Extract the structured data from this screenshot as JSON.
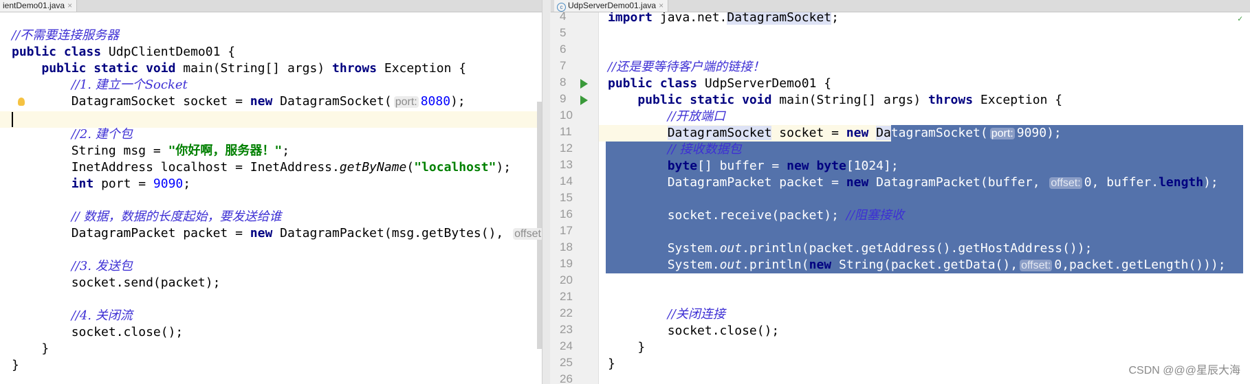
{
  "tabs": [
    {
      "label": "ientDemo01.java",
      "close": "×"
    },
    {
      "label": "UdpServerDemo01.java",
      "close": "×",
      "icon": "java-class-icon",
      "icon_glyph": "c"
    }
  ],
  "colors": {
    "selection": "#5472ab",
    "keyword": "#000080",
    "comment": "#3d2fd4",
    "string": "#008000",
    "number": "#0000ff",
    "run": "#3a9a3a"
  },
  "left_editor": {
    "lines": [
      [
        [
          "cm",
          "//不需要连接服务器"
        ]
      ],
      [
        [
          "kw",
          "public class "
        ],
        [
          "p",
          "UdpClientDemo01 {"
        ]
      ],
      [
        [
          "p",
          "    "
        ],
        [
          "kw",
          "public static void "
        ],
        [
          "p",
          "main(String[] args) "
        ],
        [
          "kw",
          "throws "
        ],
        [
          "p",
          "Exception {"
        ]
      ],
      [
        [
          "p",
          "        "
        ],
        [
          "cm",
          "//1. 建立一个Socket"
        ]
      ],
      [
        [
          "p",
          "        DatagramSocket socket = "
        ],
        [
          "kw",
          "new "
        ],
        [
          "p",
          "DatagramSocket("
        ],
        [
          "hint",
          "port:"
        ],
        [
          "num",
          "8080"
        ],
        [
          "p",
          ");"
        ]
      ],
      [],
      [
        [
          "p",
          "        "
        ],
        [
          "cm",
          "//2. 建个包"
        ]
      ],
      [
        [
          "p",
          "        String msg = "
        ],
        [
          "str",
          "\"你好啊，服务器！\""
        ],
        [
          "p",
          ";"
        ]
      ],
      [
        [
          "p",
          "        InetAddress localhost = InetAddress."
        ],
        [
          "it",
          "getByName"
        ],
        [
          "p",
          "("
        ],
        [
          "str",
          "\"localhost\""
        ],
        [
          "p",
          ");"
        ]
      ],
      [
        [
          "p",
          "        "
        ],
        [
          "kw",
          "int "
        ],
        [
          "p",
          "port = "
        ],
        [
          "num",
          "9090"
        ],
        [
          "p",
          ";"
        ]
      ],
      [],
      [
        [
          "p",
          "        "
        ],
        [
          "cm",
          "// 数据，数据的长度起始，要发送给谁"
        ]
      ],
      [
        [
          "p",
          "        DatagramPacket packet = "
        ],
        [
          "kw",
          "new "
        ],
        [
          "p",
          "DatagramPacket(msg.getBytes(), "
        ],
        [
          "hint",
          "offset:"
        ]
      ],
      [],
      [
        [
          "p",
          "        "
        ],
        [
          "cm",
          "//3. 发送包"
        ]
      ],
      [
        [
          "p",
          "        socket.send(packet);"
        ]
      ],
      [],
      [
        [
          "p",
          "        "
        ],
        [
          "cm",
          "//4. 关闭流"
        ]
      ],
      [
        [
          "p",
          "        socket.close();"
        ]
      ],
      [
        [
          "p",
          "    }"
        ]
      ],
      [
        [
          "p",
          "}"
        ]
      ]
    ]
  },
  "right_editor": {
    "first_line_number": 4,
    "lines": [
      [
        [
          "kw",
          "import "
        ],
        [
          "p",
          "java.net."
        ],
        [
          "us",
          "DatagramSocket"
        ],
        [
          "p",
          ";"
        ]
      ],
      [],
      [],
      [
        [
          "cm",
          "//还是要等待客户端的链接！"
        ]
      ],
      [
        [
          "kw",
          "public class "
        ],
        [
          "p",
          "UdpServerDemo01 {"
        ]
      ],
      [
        [
          "p",
          "    "
        ],
        [
          "kw",
          "public static void "
        ],
        [
          "p",
          "main(String[] args) "
        ],
        [
          "kw",
          "throws "
        ],
        [
          "p",
          "Exception {"
        ]
      ],
      [
        [
          "p",
          "        "
        ],
        [
          "cm",
          "//开放端口"
        ]
      ],
      [
        [
          "p",
          "        "
        ],
        [
          "us",
          "DatagramSocket"
        ],
        [
          "p",
          " socket = "
        ],
        [
          "kw",
          "new "
        ],
        [
          "us",
          "Da"
        ],
        [
          "ps",
          "tagramSocket("
        ],
        [
          "hints",
          "port:"
        ],
        [
          "ps",
          "9090);"
        ]
      ],
      [
        [
          "p",
          "        "
        ],
        [
          "cm",
          "// 接收数据包"
        ]
      ],
      [
        [
          "p",
          "        "
        ],
        [
          "kw",
          "byte"
        ],
        [
          "p",
          "[] buffer = "
        ],
        [
          "kw",
          "new byte"
        ],
        [
          "p",
          "[1024];"
        ]
      ],
      [
        [
          "p",
          "        DatagramPacket packet = "
        ],
        [
          "kw",
          "new "
        ],
        [
          "p",
          "DatagramPacket(buffer, "
        ],
        [
          "hint",
          "offset:"
        ],
        [
          "p",
          "0, buffer."
        ],
        [
          "kw",
          "length"
        ],
        [
          "p",
          ");"
        ]
      ],
      [],
      [
        [
          "p",
          "        socket.receive(packet); "
        ],
        [
          "cm",
          "//阻塞接收"
        ]
      ],
      [],
      [
        [
          "p",
          "        System."
        ],
        [
          "it",
          "out"
        ],
        [
          "p",
          ".println(packet.getAddress().getHostAddress());"
        ]
      ],
      [
        [
          "p",
          "        System."
        ],
        [
          "it",
          "out"
        ],
        [
          "p",
          ".println("
        ],
        [
          "kw",
          "new "
        ],
        [
          "p",
          "String(packet.getData(),"
        ],
        [
          "hint",
          "offset:"
        ],
        [
          "p",
          "0,packet.getLength()));"
        ]
      ],
      [],
      [],
      [
        [
          "p",
          "        "
        ],
        [
          "cm",
          "//关闭连接"
        ]
      ],
      [
        [
          "p",
          "        socket.close();"
        ]
      ],
      [
        [
          "p",
          "    }"
        ]
      ],
      [
        [
          "p",
          "}"
        ]
      ],
      []
    ],
    "selected_lines": [
      12,
      13,
      14,
      15,
      16,
      17,
      18,
      19
    ],
    "partial_selection_line": 11,
    "run_lines": [
      8,
      9
    ]
  },
  "watermark": "CSDN @@@星辰大海"
}
